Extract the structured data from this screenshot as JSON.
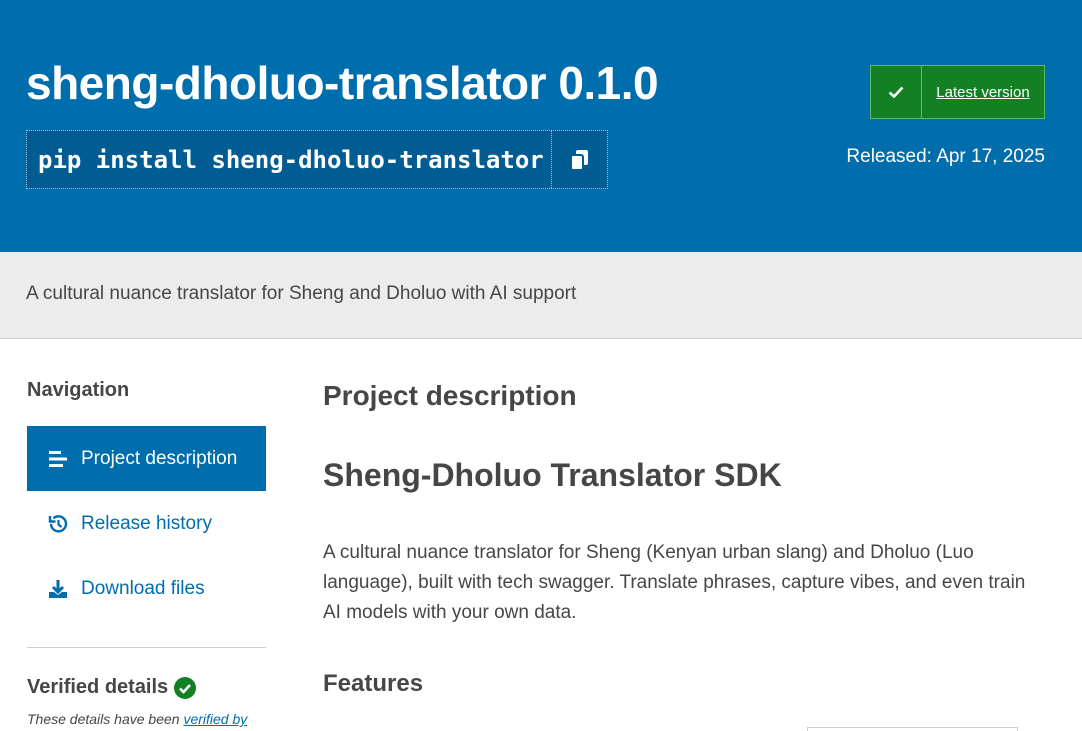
{
  "header": {
    "title": "sheng-dholuo-translator 0.1.0",
    "pip_command": "pip install sheng-dholuo-translator",
    "latest_version_label": "Latest version",
    "released": "Released: Apr 17, 2025",
    "colors": {
      "banner": "#006dad",
      "latest_badge": "#148024"
    }
  },
  "summary": "A cultural nuance translator for Sheng and Dholuo with AI support",
  "sidebar": {
    "heading": "Navigation",
    "items": [
      {
        "label": "Project description",
        "icon": "list-icon",
        "active": true
      },
      {
        "label": "Release history",
        "icon": "history-icon",
        "active": false
      },
      {
        "label": "Download files",
        "icon": "download-icon",
        "active": false
      }
    ],
    "verified_heading": "Verified details",
    "verified_note_prefix": "These details have been ",
    "verified_note_link": "verified by"
  },
  "main": {
    "heading": "Project description",
    "h1": "Sheng-Dholuo Translator SDK",
    "paragraph": "A cultural nuance translator for Sheng (Kenyan urban slang) and Dholuo (Luo language), built with tech swagger. Translate phrases, capture vibes, and even train AI models with your own data.",
    "h2": "Features"
  }
}
